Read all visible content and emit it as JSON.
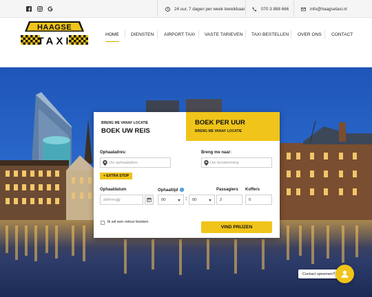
{
  "topbar": {
    "social": [
      {
        "name": "facebook"
      },
      {
        "name": "instagram"
      },
      {
        "name": "google"
      }
    ],
    "hours_text": "24 uur, 7 dagen per week bereikbaar!",
    "phone_text": "070 3 888 666",
    "email_text": "info@haagsetaxi.nl"
  },
  "logo": {
    "top_text": "HAAGSE",
    "bottom_text": "TAXI"
  },
  "nav": {
    "items": [
      {
        "label": "HOME",
        "active": true
      },
      {
        "label": "DIENSTEN"
      },
      {
        "label": "AIRPORT TAXI"
      },
      {
        "label": "VASTE TARIEVEN"
      },
      {
        "label": "TAXI BESTELLEN"
      },
      {
        "label": "OVER ONS"
      },
      {
        "label": "CONTACT"
      }
    ]
  },
  "booking": {
    "tab1": {
      "small": "BRENG ME VANAF LOCATIE",
      "big": "BOEK UW REIS"
    },
    "tab2": {
      "big": "BOEK PER UUR",
      "small": "BRENG ME VANAF LOCATIE"
    },
    "pickup": {
      "label": "Ophaaladres:",
      "placeholder": "Uw ophaaladres"
    },
    "dropoff": {
      "label": "Breng me naar:",
      "placeholder": "Uw bestemming"
    },
    "extra_stop": "+ EXTRA STOP",
    "date": {
      "label": "Ophaaldatum",
      "placeholder": "dd/mm/jjjj"
    },
    "time": {
      "label": "Ophaaltijd",
      "hour": "00",
      "minute": "00",
      "separator": ":"
    },
    "passengers": {
      "label": "Passagiers",
      "value": "2"
    },
    "suitcases": {
      "label": "Koffers",
      "value": "0"
    },
    "return_label": "Ik wil een retour boeken",
    "submit_label": "VIND PRIJZEN"
  },
  "contact": {
    "bubble_text": "Contact opnemen?"
  },
  "colors": {
    "accent": "#f0c419",
    "dark": "#111111"
  }
}
